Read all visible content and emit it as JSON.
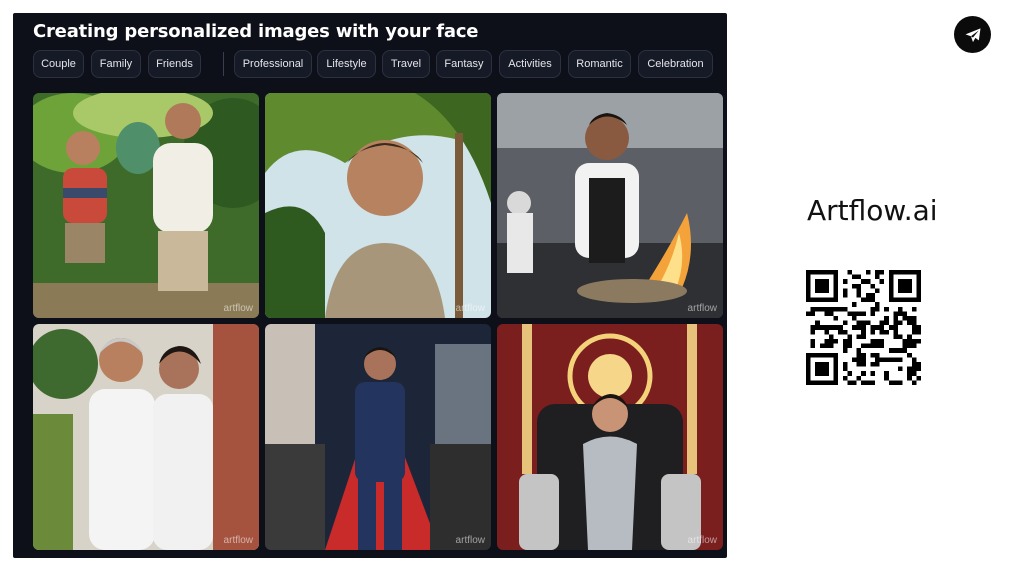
{
  "panel": {
    "title": "Creating personalized images with your face",
    "chips": [
      "Couple",
      "Family",
      "Friends",
      "Professional",
      "Lifestyle",
      "Travel",
      "Fantasy",
      "Activities",
      "Romantic",
      "Celebration"
    ]
  },
  "gallery": {
    "watermark": "artflow",
    "images": [
      {
        "name": "boy-grandmother-dinosaur-jungle"
      },
      {
        "name": "young-man-palm-trees"
      },
      {
        "name": "chef-cooking-flames-kitchen"
      },
      {
        "name": "two-women-white-outfits"
      },
      {
        "name": "man-suit-red-carpet"
      },
      {
        "name": "woman-silver-dress-throne"
      }
    ]
  },
  "sidebar": {
    "brand": "Artflow.ai",
    "telegram_icon": "telegram-icon",
    "qr_icon": "qr-code"
  }
}
